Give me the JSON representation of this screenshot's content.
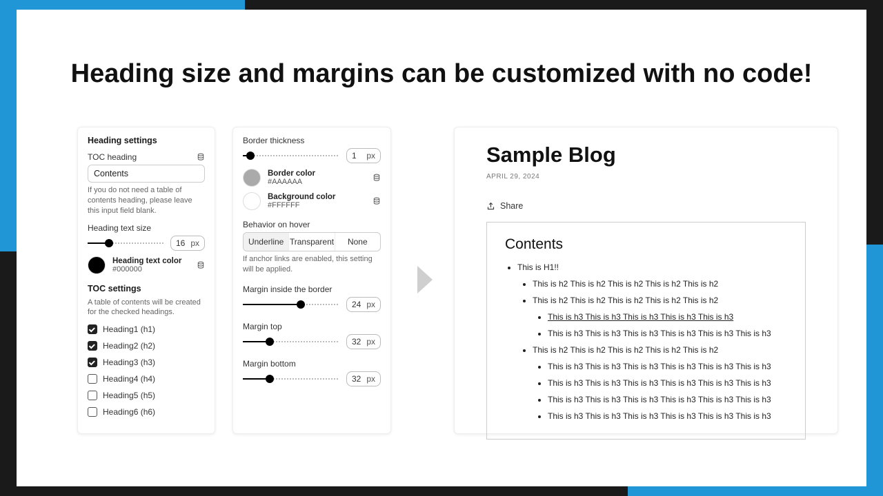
{
  "headline": "Heading size and margins can be customized with no code!",
  "panelA": {
    "sectionTitle": "Heading settings",
    "tocHeadingLabel": "TOC heading",
    "tocHeadingValue": "Contents",
    "tocHeadingHelp": "If you do not need a table of contents heading, please leave this input field blank.",
    "textSizeLabel": "Heading text size",
    "textSizeValue": "16",
    "textSizeUnit": "px",
    "textColor": {
      "label": "Heading text color",
      "hex": "#000000"
    },
    "tocSettingsTitle": "TOC settings",
    "tocSettingsHelp": "A table of contents will be created for the checked headings.",
    "headings": [
      {
        "label": "Heading1 (h1)",
        "checked": true
      },
      {
        "label": "Heading2 (h2)",
        "checked": true
      },
      {
        "label": "Heading3 (h3)",
        "checked": true
      },
      {
        "label": "Heading4 (h4)",
        "checked": false
      },
      {
        "label": "Heading5 (h5)",
        "checked": false
      },
      {
        "label": "Heading6 (h6)",
        "checked": false
      }
    ]
  },
  "panelB": {
    "borderThicknessLabel": "Border thickness",
    "borderThicknessValue": "1",
    "borderColor": {
      "label": "Border color",
      "hex": "#AAAAAA"
    },
    "bgColor": {
      "label": "Background color",
      "hex": "#FFFFFF"
    },
    "hoverLabel": "Behavior on hover",
    "hoverSeg": {
      "opt1": "Underline",
      "opt2": "Transparent",
      "opt3": "None"
    },
    "hoverHelp": "If anchor links are enabled, this setting will be applied.",
    "marginInsideLabel": "Margin inside the border",
    "marginInsideValue": "24",
    "marginTopLabel": "Margin top",
    "marginTopValue": "32",
    "marginBottomLabel": "Margin bottom",
    "marginBottomValue": "32",
    "unit": "px"
  },
  "preview": {
    "title": "Sample Blog",
    "date": "APRIL 29, 2024",
    "shareLabel": "Share",
    "tocTitle": "Contents",
    "items": {
      "h1": "This is H1!!",
      "h2a": "This is h2 This is h2 This is h2 This is h2 This is h2",
      "h2b": "This is h2 This is h2 This is h2 This is h2 This is h2",
      "h3a": "This is h3 This is h3 This is h3 This is h3 This is h3",
      "h3b": "This is h3 This is h3 This is h3 This is h3 This is h3 This is h3",
      "h2c": "This is h2 This is h2 This is h2 This is h2 This is h2",
      "h3c": "This is h3 This is h3 This is h3 This is h3 This is h3 This is h3",
      "h3d": "This is h3 This is h3 This is h3 This is h3 This is h3 This is h3",
      "h3e": "This is h3 This is h3 This is h3 This is h3 This is h3 This is h3",
      "h3f": "This is h3 This is h3 This is h3 This is h3 This is h3 This is h3"
    }
  }
}
